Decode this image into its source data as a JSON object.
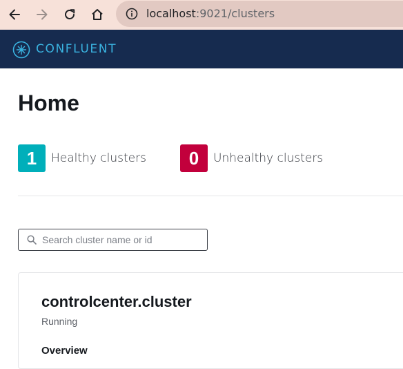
{
  "browser": {
    "url_host": "localhost",
    "url_path": ":9021/clusters"
  },
  "header": {
    "brand": "CONFLUENT"
  },
  "page": {
    "title": "Home"
  },
  "summary": {
    "healthy_count": "1",
    "healthy_label": "Healthy clusters",
    "unhealthy_count": "0",
    "unhealthy_label": "Unhealthy clusters"
  },
  "search": {
    "placeholder": "Search cluster name or id",
    "value": ""
  },
  "clusters": [
    {
      "name": "controlcenter.cluster",
      "status": "Running",
      "section_label": "Overview"
    }
  ],
  "colors": {
    "browser_bar": "#f7e1d9",
    "header_bg": "#162b4f",
    "brand": "#3ab3e0",
    "healthy": "#00afba",
    "unhealthy": "#c2003c"
  }
}
